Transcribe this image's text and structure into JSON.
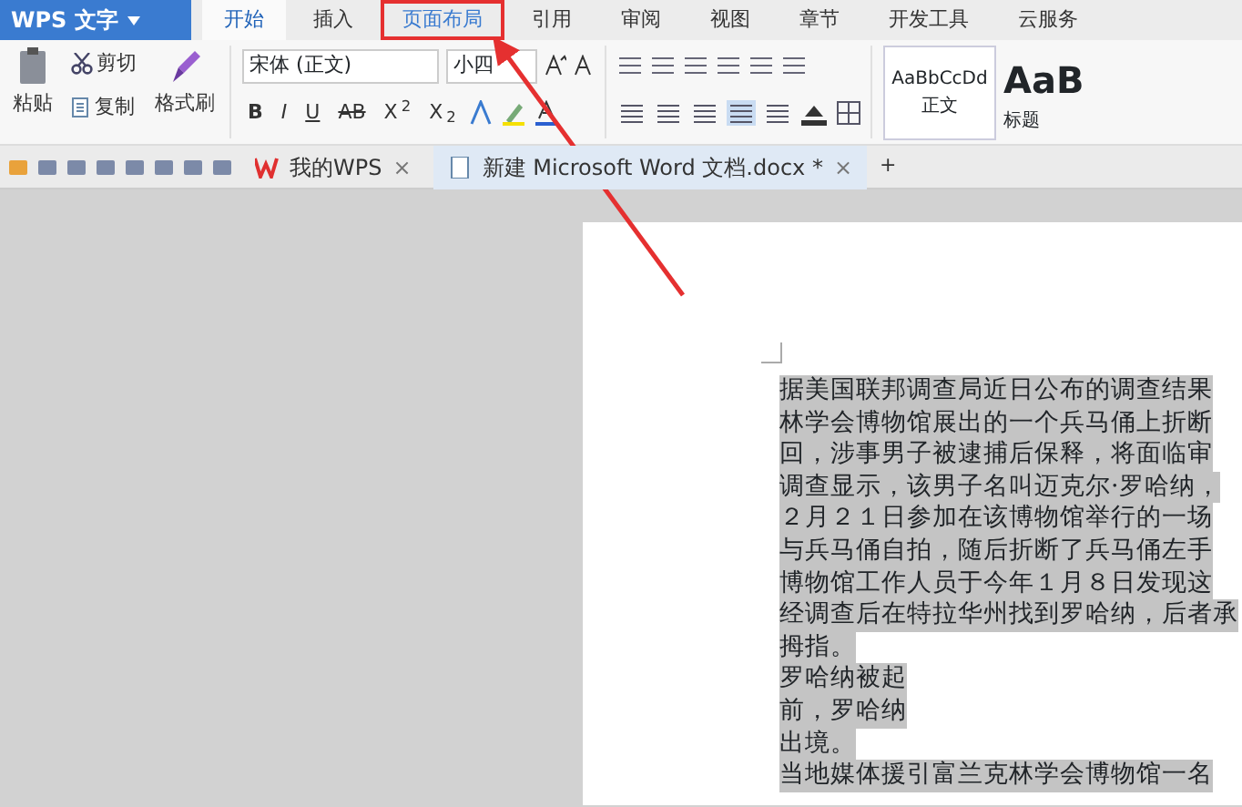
{
  "app_menu": {
    "label": "WPS 文字"
  },
  "tabs": [
    {
      "label": "开始",
      "selected": true,
      "marked": false
    },
    {
      "label": "插入",
      "selected": false,
      "marked": false
    },
    {
      "label": "页面布局",
      "selected": false,
      "marked": true
    },
    {
      "label": "引用",
      "selected": false,
      "marked": false
    },
    {
      "label": "审阅",
      "selected": false,
      "marked": false
    },
    {
      "label": "视图",
      "selected": false,
      "marked": false
    },
    {
      "label": "章节",
      "selected": false,
      "marked": false
    },
    {
      "label": "开发工具",
      "selected": false,
      "marked": false
    },
    {
      "label": "云服务",
      "selected": false,
      "marked": false
    }
  ],
  "clipboard": {
    "paste": "粘贴",
    "cut": "剪切",
    "copy": "复制",
    "format_painter": "格式刷"
  },
  "font": {
    "name": "宋体 (正文)",
    "size": "小四"
  },
  "format_buttons": [
    {
      "label": "B",
      "kind": "bold"
    },
    {
      "label": "I",
      "kind": "italic"
    },
    {
      "label": "U",
      "kind": "underline"
    },
    {
      "label": "AB",
      "kind": "strike"
    },
    {
      "label": "X$^{2}$",
      "kind": "plain"
    },
    {
      "label": "X$_{2}$",
      "kind": "plain"
    }
  ],
  "align_buttons": [
    {
      "selected": false
    },
    {
      "selected": false
    },
    {
      "selected": false
    },
    {
      "selected": true
    },
    {
      "selected": false
    }
  ],
  "styles": [
    {
      "preview": "AaBbCcDd",
      "label": "正文",
      "kind": "normal"
    },
    {
      "preview": "AaB",
      "label": "标题",
      "kind": "heading"
    }
  ],
  "doc_tabs": [
    {
      "label": "我的WPS",
      "close": "×",
      "selected": false
    },
    {
      "label": "新建 Microsoft Word 文档.docx *",
      "close": "×",
      "selected": true
    }
  ],
  "new_tab": "+",
  "document": {
    "selected": true,
    "lines": [
      "据美国联邦调查局近日公布的调查结果",
      "林学会博物馆展出的一个兵马俑上折断",
      "回，涉事男子被逮捕后保释，将面临审",
      "调查显示，该男子名叫迈克尔·罗哈纳，",
      "２月２１日参加在该博物馆举行的一场",
      "与兵马俑自拍，随后折断了兵马俑左手",
      "博物馆工作人员于今年１月８日发现这",
      "经调查后在特拉华州找到罗哈纳，后者承",
      "拇指。",
      "罗哈纳被起",
      "前，罗哈纳",
      "出境。",
      "当地媒体援引富兰克林学会博物馆一名"
    ]
  }
}
